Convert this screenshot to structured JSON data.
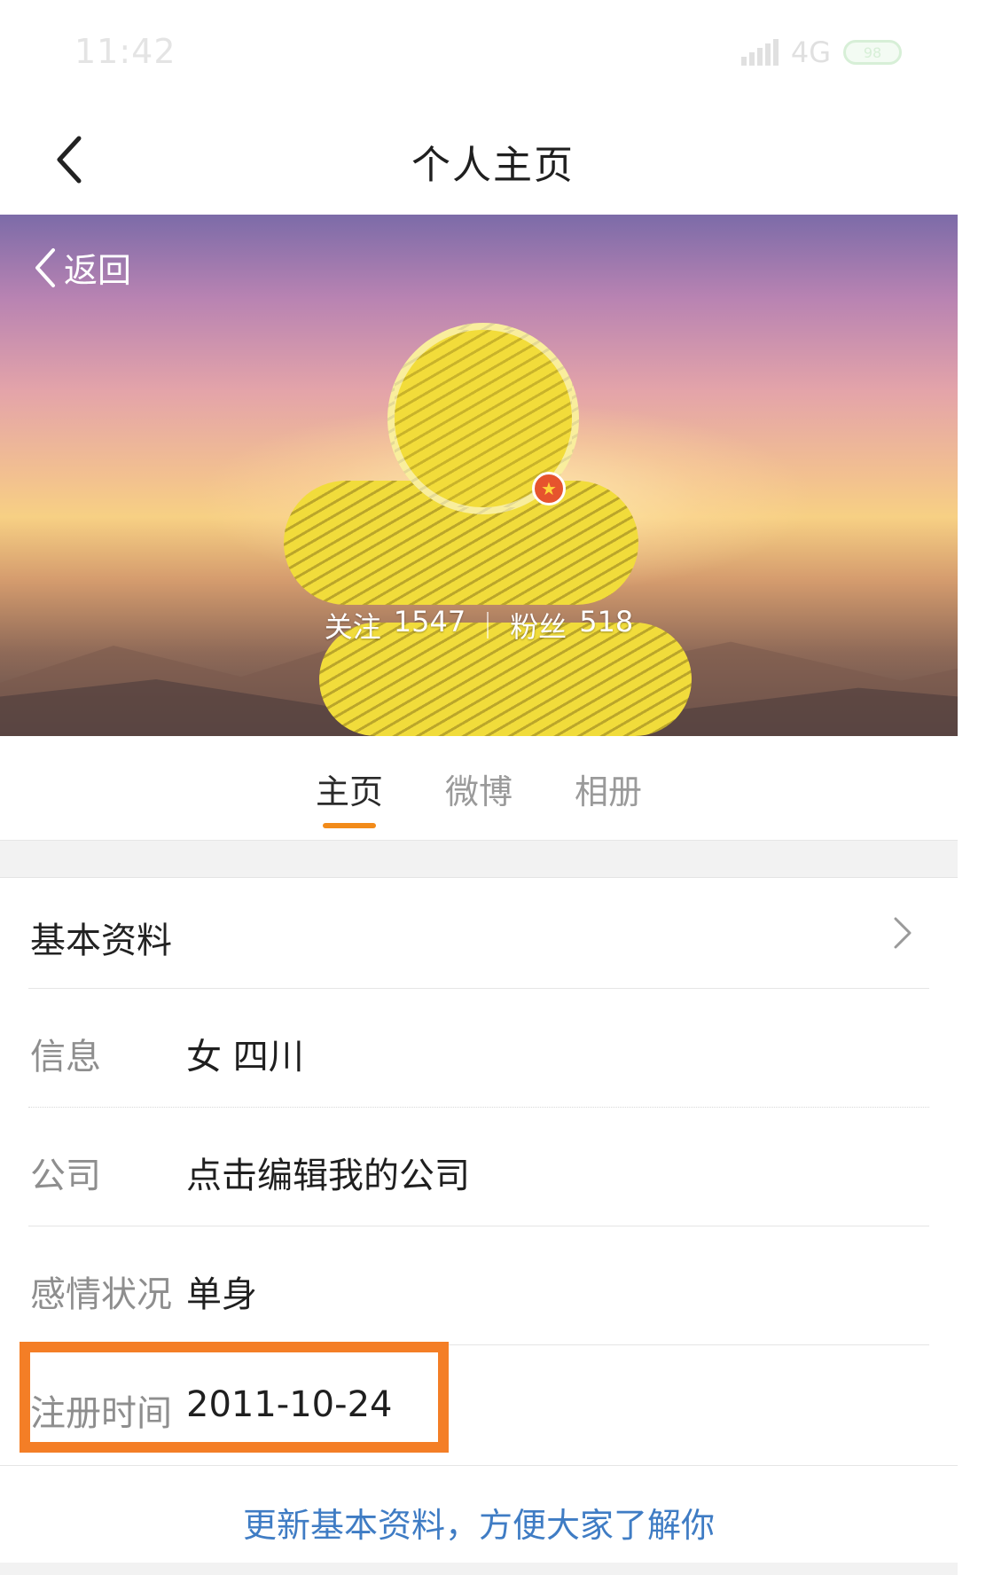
{
  "status_bar": {
    "time": "11:42",
    "network": "4G",
    "battery": "98"
  },
  "nav": {
    "title": "个人主页"
  },
  "banner": {
    "back_label": "返回",
    "stats": {
      "follow_label": "关注",
      "follow_count": "1547",
      "fans_label": "粉丝",
      "fans_count": "518"
    }
  },
  "tabs": [
    {
      "label": "主页",
      "active": true
    },
    {
      "label": "微博",
      "active": false
    },
    {
      "label": "相册",
      "active": false
    }
  ],
  "basic_info": {
    "title": "基本资料",
    "rows": [
      {
        "label": "信息",
        "value": "女 四川"
      },
      {
        "label": "公司",
        "value": "点击编辑我的公司"
      },
      {
        "label": "感情状况",
        "value": "单身"
      },
      {
        "label": "注册时间",
        "value": "2011-10-24"
      }
    ],
    "update_link": "更新基本资料，方便大家了解你"
  },
  "colors": {
    "accent": "#f28b1a",
    "highlight": "#f47e26",
    "link": "#3f7cc4"
  }
}
